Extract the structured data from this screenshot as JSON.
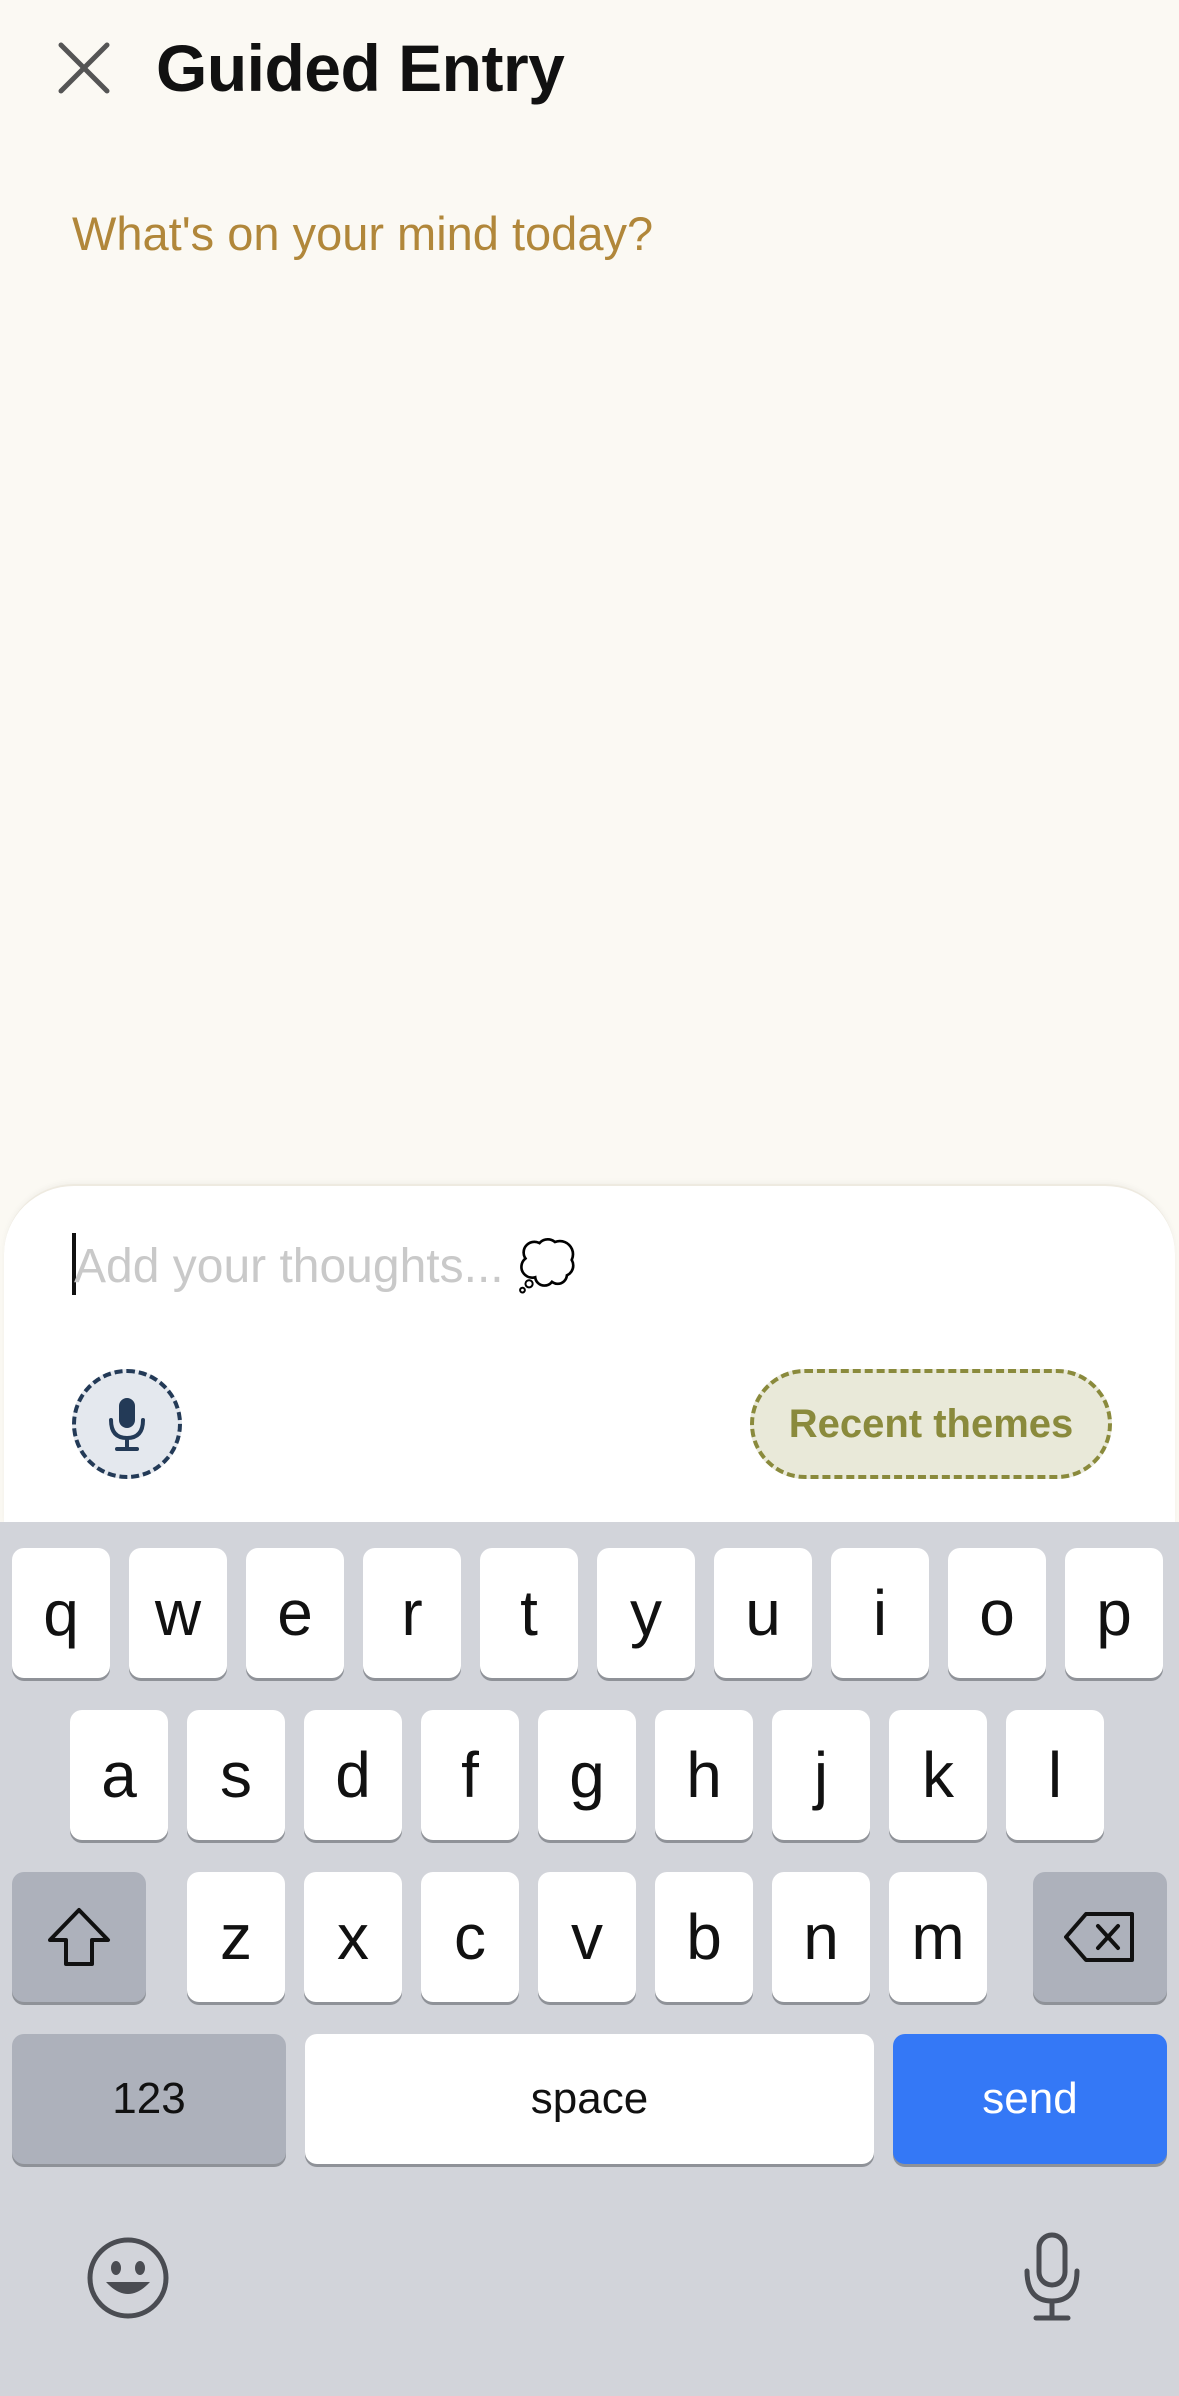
{
  "header": {
    "title": "Guided Entry",
    "prompt": "What's on your mind today?"
  },
  "composer": {
    "placeholder": "Add your thoughts... 💭",
    "themes_label": "Recent themes",
    "colors": {
      "mic_border": "#233a57",
      "themes_accent": "#8a8a3c",
      "prompt": "#b1873a"
    }
  },
  "keyboard": {
    "row1": [
      "q",
      "w",
      "e",
      "r",
      "t",
      "y",
      "u",
      "i",
      "o",
      "p"
    ],
    "row2": [
      "a",
      "s",
      "d",
      "f",
      "g",
      "h",
      "j",
      "k",
      "l"
    ],
    "row3": [
      "z",
      "x",
      "c",
      "v",
      "b",
      "n",
      "m"
    ],
    "num_label": "123",
    "space_label": "space",
    "send_label": "send",
    "send_color": "#3478f6"
  },
  "icons": {
    "close": "close-icon",
    "thought": "thought-bubble-icon",
    "mic": "microphone-icon",
    "shift": "shift-icon",
    "backspace": "backspace-icon",
    "emoji": "emoji-icon",
    "dictation": "dictation-icon"
  }
}
